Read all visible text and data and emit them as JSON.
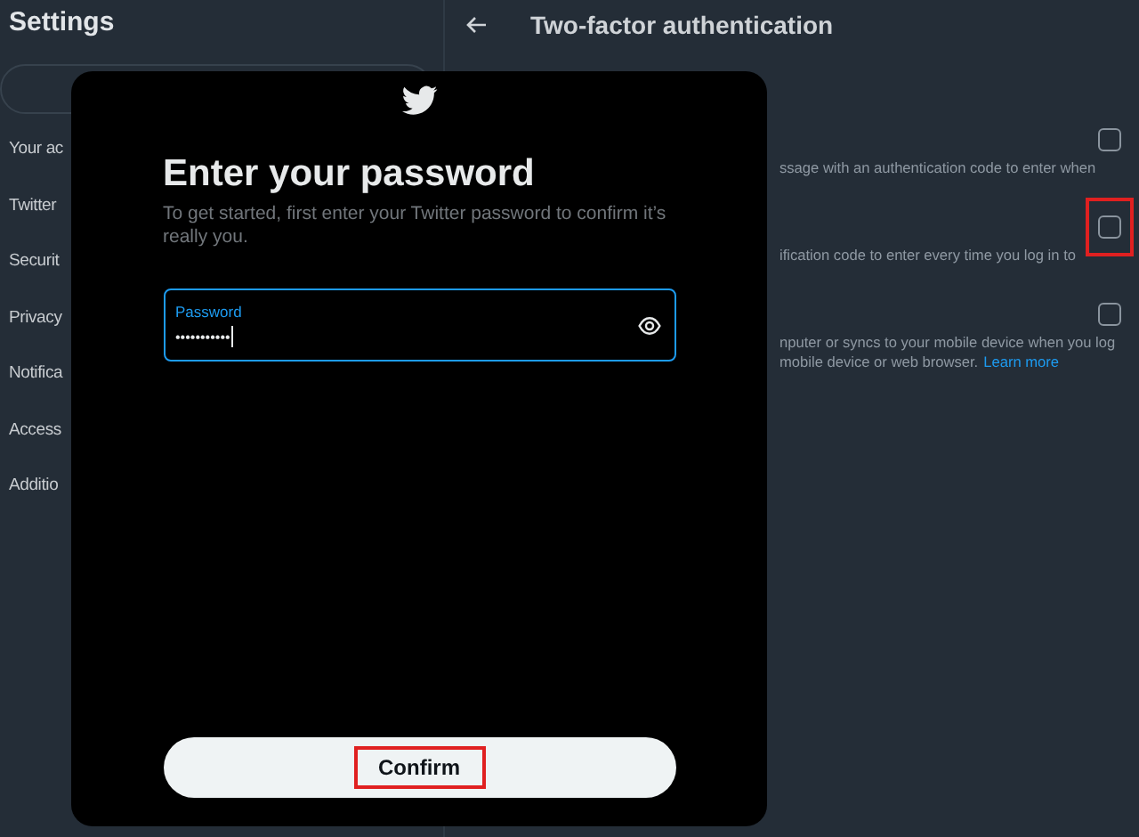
{
  "sidebar": {
    "title": "Settings",
    "items": [
      {
        "label": "Your ac"
      },
      {
        "label": "Twitter"
      },
      {
        "label": "Securit"
      },
      {
        "label": "Privacy"
      },
      {
        "label": "Notifica"
      },
      {
        "label": "Access"
      },
      {
        "label": "Additio"
      }
    ]
  },
  "main": {
    "title": "Two-factor authentication",
    "options": [
      {
        "lines": [
          "ssage with an authentication code to enter when"
        ],
        "checked": false,
        "highlighted": false
      },
      {
        "lines": [
          "ification code to enter every time you log in to"
        ],
        "checked": false,
        "highlighted": true
      },
      {
        "lines": [
          "nputer or syncs to your mobile device when you log",
          "mobile device or web browser."
        ],
        "link": "Learn more",
        "checked": false,
        "highlighted": false
      }
    ]
  },
  "dialog": {
    "title": "Enter your password",
    "subtitle": "To get started, first enter your Twitter password to confirm it’s really you.",
    "field": {
      "label": "Password",
      "value": "•••••••••••",
      "focused": true
    },
    "button": {
      "label": "Confirm",
      "highlighted": true
    }
  }
}
